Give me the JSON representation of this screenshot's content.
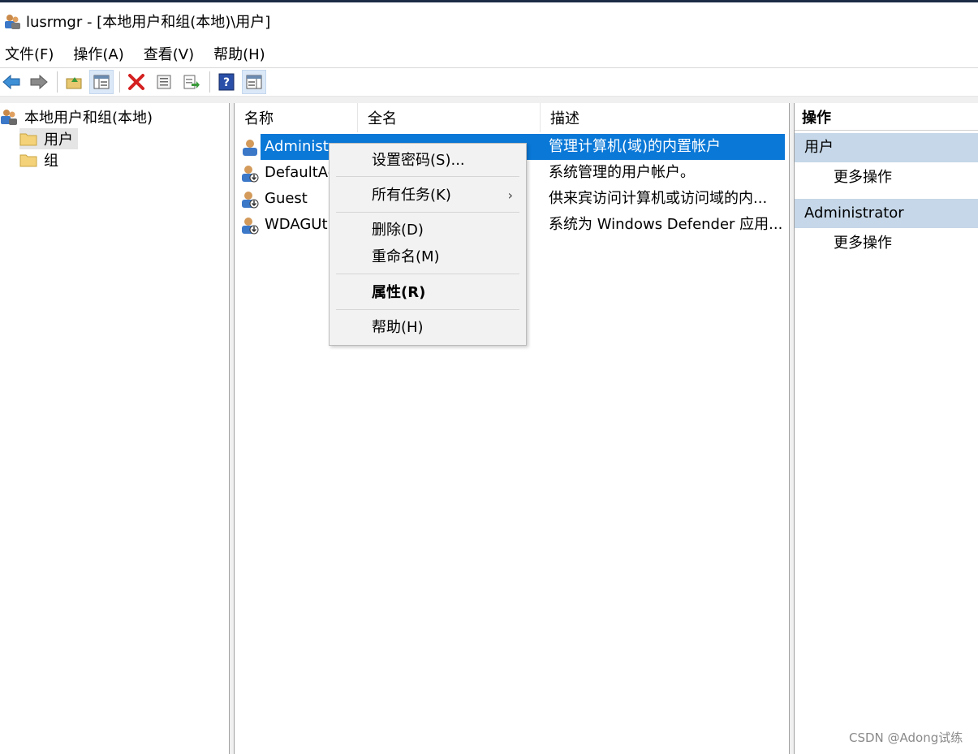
{
  "window": {
    "title": "lusrmgr - [本地用户和组(本地)\\用户]"
  },
  "menu": [
    "文件(F)",
    "操作(A)",
    "查看(V)",
    "帮助(H)"
  ],
  "toolbar": {
    "icons": [
      "back-arrow-icon",
      "forward-arrow-icon",
      "up-folder-icon",
      "show-hide-tree-icon",
      "delete-icon",
      "properties-icon",
      "export-list-icon",
      "help-icon",
      "show-hide-action-pane-icon"
    ]
  },
  "tree": {
    "root": "本地用户和组(本地)",
    "items": [
      {
        "label": "用户",
        "selected": true
      },
      {
        "label": "组",
        "selected": false
      }
    ]
  },
  "list": {
    "columns": [
      "名称",
      "全名",
      "描述"
    ],
    "rows": [
      {
        "name": "Administrator",
        "fullname": "",
        "desc": "管理计算机(域)的内置帐户",
        "selected": true
      },
      {
        "name": "DefaultAccount",
        "fullname": "",
        "desc": "系统管理的用户帐户。",
        "selected": false
      },
      {
        "name": "Guest",
        "fullname": "",
        "desc": "供来宾访问计算机或访问域的内...",
        "selected": false
      },
      {
        "name": "WDAGUtilityAccount",
        "fullname": "",
        "desc": "系统为 Windows Defender 应用...",
        "selected": false
      }
    ]
  },
  "context_menu": {
    "items": [
      {
        "label": "设置密码(S)..."
      },
      {
        "label": "所有任务(K)",
        "submenu": true
      },
      {
        "label": "删除(D)"
      },
      {
        "label": "重命名(M)"
      },
      {
        "label": "属性(R)",
        "bold": true
      },
      {
        "label": "帮助(H)"
      }
    ]
  },
  "actions": {
    "title": "操作",
    "sections": [
      {
        "header": "用户",
        "items": [
          "更多操作"
        ]
      },
      {
        "header": "Administrator",
        "items": [
          "更多操作"
        ]
      }
    ]
  },
  "watermark": "CSDN @Adong试练",
  "colors": {
    "selection": "#0a78d7",
    "section_header": "#c5d7e8"
  }
}
